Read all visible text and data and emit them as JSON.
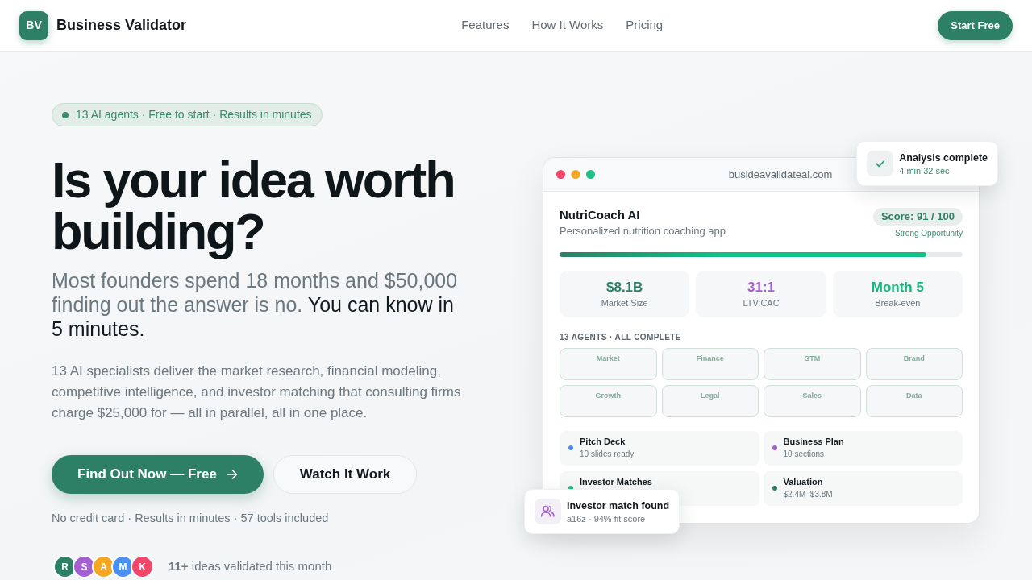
{
  "navbar": {
    "logo_mark": "BV",
    "brand": "Business Validator",
    "links": [
      "Features",
      "How It Works",
      "Pricing"
    ],
    "cta": "Start Free"
  },
  "hero": {
    "badge": "13 AI agents · Free to start · Results in minutes",
    "headline": "Is your idea worth building?",
    "subheadline": {
      "muted": "Most founders spend 18 months and $50,000 finding out the answer is no.",
      "emphasis": "You can know in 5 minutes."
    },
    "description": "13 AI specialists deliver the market research, financial modeling, competitive intelligence, and investor matching that consulting firms charge $25,000 for — all in parallel, all in one place.",
    "primary_button": "Find Out Now — Free",
    "secondary_button": "Watch It Work",
    "fine_print": "No credit card · Results in minutes · 57 tools included",
    "avatars": [
      {
        "initial": "R",
        "color": "#2d7f66"
      },
      {
        "initial": "S",
        "color": "#a45fd0"
      },
      {
        "initial": "A",
        "color": "#f5a623"
      },
      {
        "initial": "M",
        "color": "#4a90f0"
      },
      {
        "initial": "K",
        "color": "#f0476a"
      }
    ],
    "social_proof": "**11+** ideas validated this month"
  },
  "preview": {
    "url": "busideavalidateai.com",
    "project": {
      "name": "NutriCoach AI",
      "tagline": "Personalized nutrition coaching app"
    },
    "score": {
      "label": "Score: 91 / 100",
      "verdict": "Strong Opportunity",
      "level": 0.91
    },
    "stats": [
      {
        "value": "$8.1B",
        "label": "Market Size",
        "color": "#2d7f66"
      },
      {
        "value": "31:1",
        "label": "LTV:CAC",
        "color": "#a45fd0"
      },
      {
        "value": "Month 5",
        "label": "Break-even",
        "color": "#17b67c"
      }
    ],
    "agents_heading": "13 AGENTS · ALL COMPLETE",
    "agents": [
      "Market",
      "Finance",
      "GTM",
      "Brand",
      "Growth",
      "Legal",
      "Sales",
      "Data"
    ],
    "deliverables": [
      {
        "title": "Pitch Deck",
        "detail": "10 slides ready",
        "color": "#4a8af4"
      },
      {
        "title": "Business Plan",
        "detail": "10 sections",
        "color": "#a45fd0"
      },
      {
        "title": "Investor Matches",
        "color": "#1dbf84"
      },
      {
        "title": "Valuation",
        "detail": "$2.4M–$3.8M",
        "color": "#2d7f66"
      }
    ]
  },
  "toasts": [
    {
      "kind": "success",
      "title": "Analysis complete",
      "detail": "4 min 32 sec"
    },
    {
      "kind": "match",
      "title": "Investor match found",
      "detail": "a16z · 94% fit score"
    }
  ]
}
